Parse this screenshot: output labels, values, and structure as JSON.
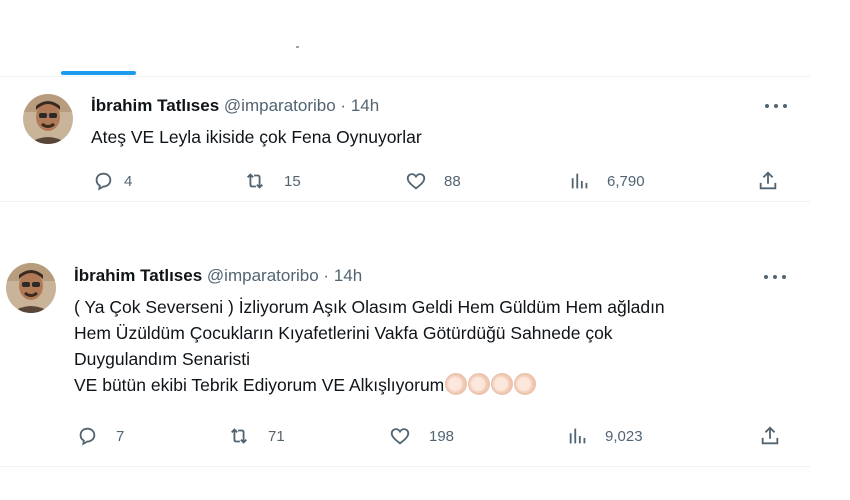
{
  "feed": {
    "tweets": [
      {
        "author_name": "İbrahim Tatlıses",
        "handle": "@imparatoribo",
        "separator": "·",
        "time": "14h",
        "text_lines": [
          "Ateş VE Leyla ikiside çok Fena Oynuyorlar"
        ],
        "replies": "4",
        "retweets": "15",
        "likes": "88",
        "views": "6,790",
        "more_icon": "more-horizontal-icon",
        "reply_icon": "reply-icon",
        "retweet_icon": "retweet-icon",
        "like_icon": "heart-icon",
        "views_icon": "views-chart-icon",
        "share_icon": "share-icon"
      },
      {
        "author_name": "İbrahim Tatlıses",
        "handle": "@imparatoribo",
        "separator": "·",
        "time": "14h",
        "text_lines": [
          "( Ya Çok Severseni ) İzliyorum Aşık Olasım Geldi Hem Güldüm Hem ağladın",
          "Hem Üzüldüm Çocukların Kıyafetlerini Vakfa Götürdüğü Sahnede çok",
          "Duygulandım Senaristi",
          "VE bütün ekibi Tebrik Ediyorum VE Alkışlıyorum"
        ],
        "emoji_name": "clapping-hands-emoji",
        "replies": "7",
        "retweets": "71",
        "likes": "198",
        "views": "9,023"
      }
    ]
  },
  "colors": {
    "accent": "#1d9bf0",
    "secondary_text": "#536471",
    "primary_text": "#0f1419",
    "divider": "#eff3f4"
  }
}
